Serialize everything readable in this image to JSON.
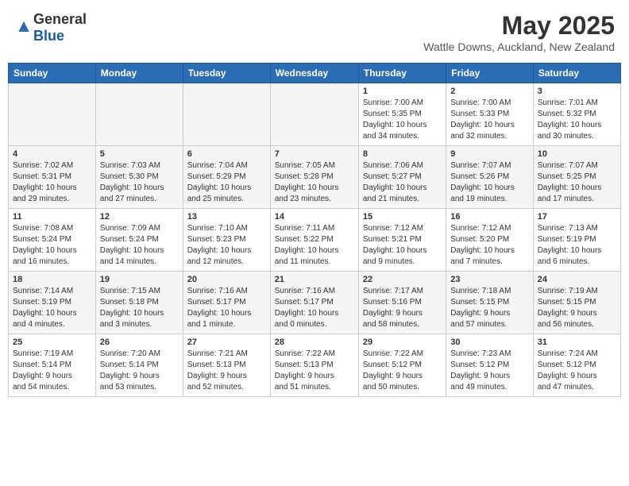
{
  "header": {
    "logo_general": "General",
    "logo_blue": "Blue",
    "month": "May 2025",
    "location": "Wattle Downs, Auckland, New Zealand"
  },
  "weekdays": [
    "Sunday",
    "Monday",
    "Tuesday",
    "Wednesday",
    "Thursday",
    "Friday",
    "Saturday"
  ],
  "weeks": [
    [
      {
        "day": "",
        "info": ""
      },
      {
        "day": "",
        "info": ""
      },
      {
        "day": "",
        "info": ""
      },
      {
        "day": "",
        "info": ""
      },
      {
        "day": "1",
        "info": "Sunrise: 7:00 AM\nSunset: 5:35 PM\nDaylight: 10 hours\nand 34 minutes."
      },
      {
        "day": "2",
        "info": "Sunrise: 7:00 AM\nSunset: 5:33 PM\nDaylight: 10 hours\nand 32 minutes."
      },
      {
        "day": "3",
        "info": "Sunrise: 7:01 AM\nSunset: 5:32 PM\nDaylight: 10 hours\nand 30 minutes."
      }
    ],
    [
      {
        "day": "4",
        "info": "Sunrise: 7:02 AM\nSunset: 5:31 PM\nDaylight: 10 hours\nand 29 minutes."
      },
      {
        "day": "5",
        "info": "Sunrise: 7:03 AM\nSunset: 5:30 PM\nDaylight: 10 hours\nand 27 minutes."
      },
      {
        "day": "6",
        "info": "Sunrise: 7:04 AM\nSunset: 5:29 PM\nDaylight: 10 hours\nand 25 minutes."
      },
      {
        "day": "7",
        "info": "Sunrise: 7:05 AM\nSunset: 5:28 PM\nDaylight: 10 hours\nand 23 minutes."
      },
      {
        "day": "8",
        "info": "Sunrise: 7:06 AM\nSunset: 5:27 PM\nDaylight: 10 hours\nand 21 minutes."
      },
      {
        "day": "9",
        "info": "Sunrise: 7:07 AM\nSunset: 5:26 PM\nDaylight: 10 hours\nand 19 minutes."
      },
      {
        "day": "10",
        "info": "Sunrise: 7:07 AM\nSunset: 5:25 PM\nDaylight: 10 hours\nand 17 minutes."
      }
    ],
    [
      {
        "day": "11",
        "info": "Sunrise: 7:08 AM\nSunset: 5:24 PM\nDaylight: 10 hours\nand 16 minutes."
      },
      {
        "day": "12",
        "info": "Sunrise: 7:09 AM\nSunset: 5:24 PM\nDaylight: 10 hours\nand 14 minutes."
      },
      {
        "day": "13",
        "info": "Sunrise: 7:10 AM\nSunset: 5:23 PM\nDaylight: 10 hours\nand 12 minutes."
      },
      {
        "day": "14",
        "info": "Sunrise: 7:11 AM\nSunset: 5:22 PM\nDaylight: 10 hours\nand 11 minutes."
      },
      {
        "day": "15",
        "info": "Sunrise: 7:12 AM\nSunset: 5:21 PM\nDaylight: 10 hours\nand 9 minutes."
      },
      {
        "day": "16",
        "info": "Sunrise: 7:12 AM\nSunset: 5:20 PM\nDaylight: 10 hours\nand 7 minutes."
      },
      {
        "day": "17",
        "info": "Sunrise: 7:13 AM\nSunset: 5:19 PM\nDaylight: 10 hours\nand 6 minutes."
      }
    ],
    [
      {
        "day": "18",
        "info": "Sunrise: 7:14 AM\nSunset: 5:19 PM\nDaylight: 10 hours\nand 4 minutes."
      },
      {
        "day": "19",
        "info": "Sunrise: 7:15 AM\nSunset: 5:18 PM\nDaylight: 10 hours\nand 3 minutes."
      },
      {
        "day": "20",
        "info": "Sunrise: 7:16 AM\nSunset: 5:17 PM\nDaylight: 10 hours\nand 1 minute."
      },
      {
        "day": "21",
        "info": "Sunrise: 7:16 AM\nSunset: 5:17 PM\nDaylight: 10 hours\nand 0 minutes."
      },
      {
        "day": "22",
        "info": "Sunrise: 7:17 AM\nSunset: 5:16 PM\nDaylight: 9 hours\nand 58 minutes."
      },
      {
        "day": "23",
        "info": "Sunrise: 7:18 AM\nSunset: 5:15 PM\nDaylight: 9 hours\nand 57 minutes."
      },
      {
        "day": "24",
        "info": "Sunrise: 7:19 AM\nSunset: 5:15 PM\nDaylight: 9 hours\nand 56 minutes."
      }
    ],
    [
      {
        "day": "25",
        "info": "Sunrise: 7:19 AM\nSunset: 5:14 PM\nDaylight: 9 hours\nand 54 minutes."
      },
      {
        "day": "26",
        "info": "Sunrise: 7:20 AM\nSunset: 5:14 PM\nDaylight: 9 hours\nand 53 minutes."
      },
      {
        "day": "27",
        "info": "Sunrise: 7:21 AM\nSunset: 5:13 PM\nDaylight: 9 hours\nand 52 minutes."
      },
      {
        "day": "28",
        "info": "Sunrise: 7:22 AM\nSunset: 5:13 PM\nDaylight: 9 hours\nand 51 minutes."
      },
      {
        "day": "29",
        "info": "Sunrise: 7:22 AM\nSunset: 5:12 PM\nDaylight: 9 hours\nand 50 minutes."
      },
      {
        "day": "30",
        "info": "Sunrise: 7:23 AM\nSunset: 5:12 PM\nDaylight: 9 hours\nand 49 minutes."
      },
      {
        "day": "31",
        "info": "Sunrise: 7:24 AM\nSunset: 5:12 PM\nDaylight: 9 hours\nand 47 minutes."
      }
    ]
  ]
}
